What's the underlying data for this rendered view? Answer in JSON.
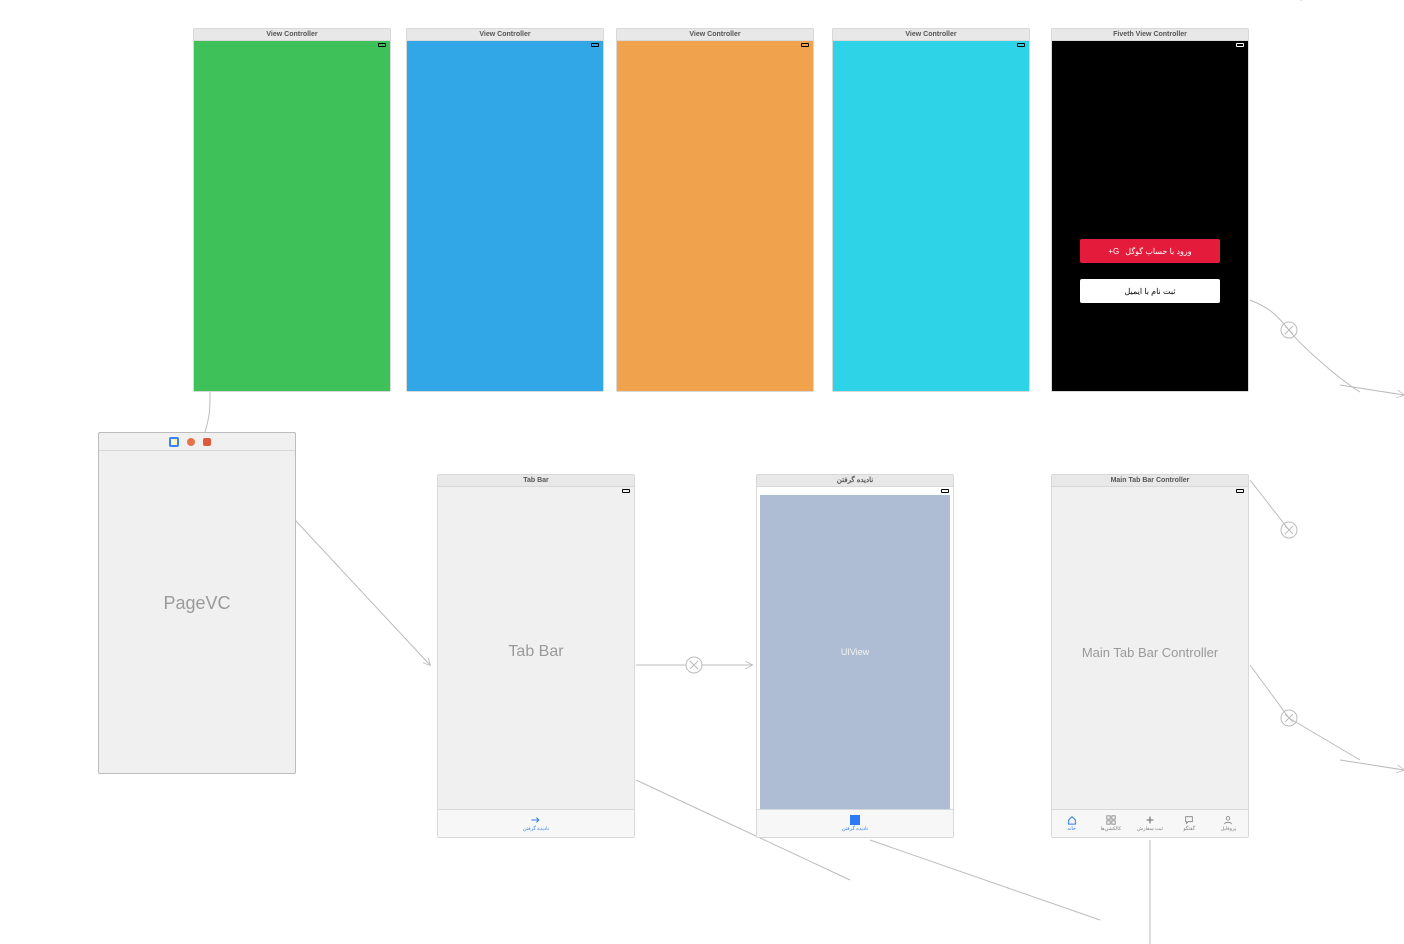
{
  "top_row": [
    {
      "title": "View Controller",
      "color": "#3fc159"
    },
    {
      "title": "View Controller",
      "color": "#32a7e8"
    },
    {
      "title": "View Controller",
      "color": "#f0a24d"
    },
    {
      "title": "View Controller",
      "color": "#2ed3e8"
    }
  ],
  "login_scene": {
    "title": "Fiveth View Controller",
    "bg": "#000000",
    "google_label": "ورود با حساب گوگل",
    "google_icon": "G+",
    "email_label": "ثبت نام با ایمیل"
  },
  "pagevc": {
    "label": "PageVC"
  },
  "tabbar_scene": {
    "title": "Tab Bar",
    "placeholder": "Tab Bar",
    "tab_label": "نادیده گرفتن"
  },
  "ignore_scene": {
    "title": "نادیده گرفتن",
    "placeholder": "UIView",
    "tab_label": "نادیده گرفتن"
  },
  "main_tab": {
    "title": "Main Tab Bar Controller",
    "placeholder": "Main Tab Bar Controller",
    "tabs": [
      {
        "label": "خانه"
      },
      {
        "label": "کالکشن‌ها"
      },
      {
        "label": "ثبت سفارش"
      },
      {
        "label": "گفتگو"
      },
      {
        "label": "پروفایل"
      }
    ]
  }
}
